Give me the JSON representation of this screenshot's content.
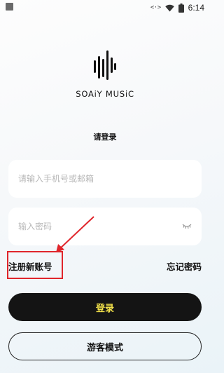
{
  "status_bar": {
    "time": "6:14",
    "code_icon": "<·>",
    "icons": [
      "notification-icon",
      "code-icon",
      "wifi-icon",
      "battery-icon"
    ]
  },
  "brand": {
    "logo_icon": "sound-bars-logo",
    "name": "SOAiY MUSiC"
  },
  "page_title": "请登录",
  "form": {
    "account_placeholder": "请输入手机号或邮箱",
    "password_placeholder": "输入密码"
  },
  "links": {
    "register": "注册新账号",
    "forgot_password": "忘记密码"
  },
  "buttons": {
    "login": "登录",
    "guest": "游客模式"
  },
  "colors": {
    "primary_button_bg": "#141414",
    "primary_button_text": "#f1e04a",
    "annotation": "#e0252b"
  }
}
